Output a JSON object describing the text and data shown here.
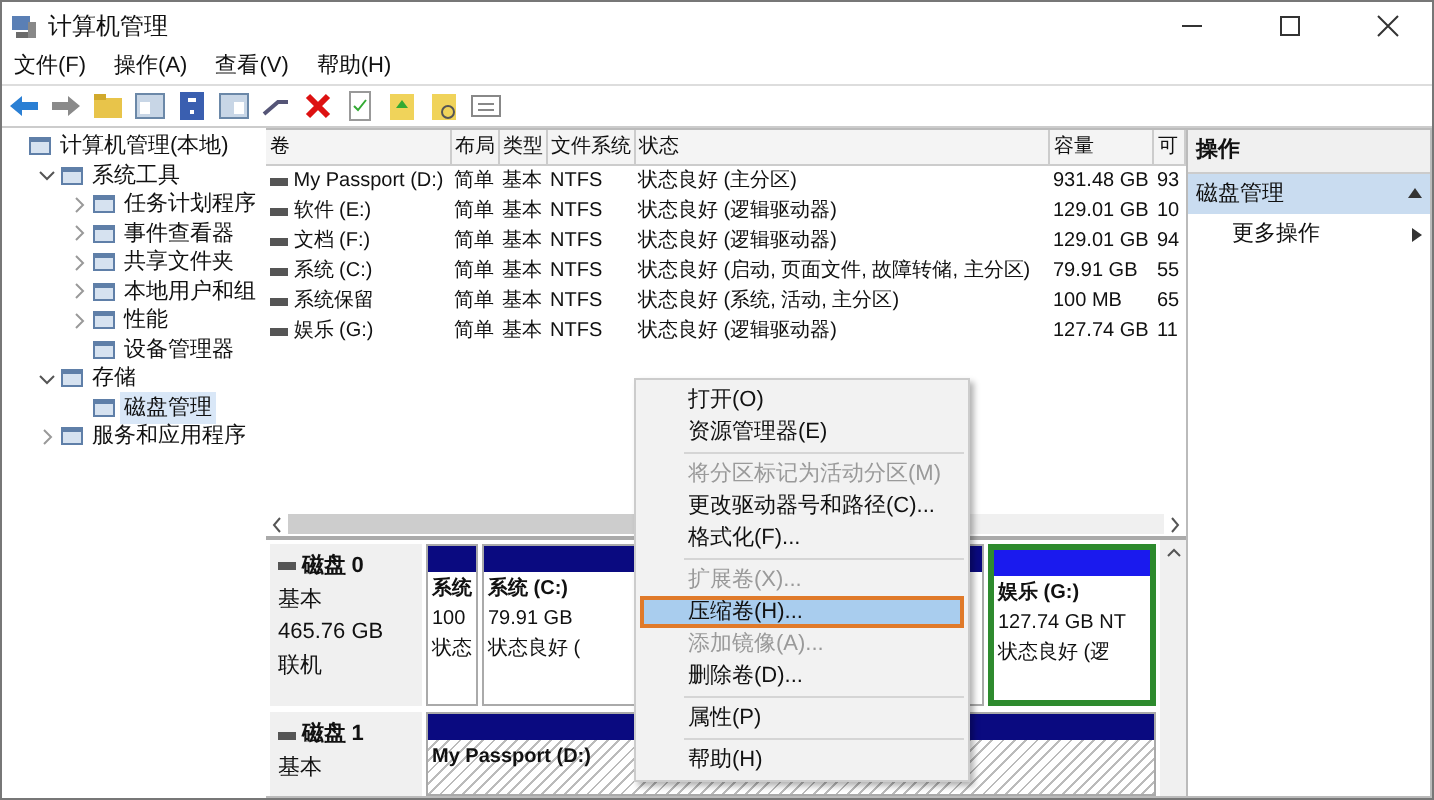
{
  "window": {
    "title": "计算机管理"
  },
  "menu": [
    "文件(F)",
    "操作(A)",
    "查看(V)",
    "帮助(H)"
  ],
  "tree": [
    {
      "label": "计算机管理(本地)",
      "selected": false,
      "children": [
        {
          "label": "系统工具",
          "expanded": true,
          "selected": false,
          "children": [
            {
              "label": "任务计划程序",
              "expanded": false,
              "selected": false
            },
            {
              "label": "事件查看器",
              "expanded": false,
              "selected": false
            },
            {
              "label": "共享文件夹",
              "expanded": false,
              "selected": false
            },
            {
              "label": "本地用户和组",
              "expanded": false,
              "selected": false
            },
            {
              "label": "性能",
              "expanded": false,
              "selected": false
            },
            {
              "label": "设备管理器",
              "selected": false
            }
          ]
        },
        {
          "label": "存储",
          "expanded": true,
          "selected": false,
          "children": [
            {
              "label": "磁盘管理",
              "selected": true
            }
          ]
        },
        {
          "label": "服务和应用程序",
          "expanded": false,
          "selected": false
        }
      ]
    }
  ],
  "table": {
    "columns": [
      "卷",
      "布局",
      "类型",
      "文件系统",
      "状态",
      "容量",
      "可"
    ],
    "rows": [
      [
        "My Passport (D:)",
        "简单",
        "基本",
        "NTFS",
        "状态良好 (主分区)",
        "931.48 GB",
        "93"
      ],
      [
        "软件 (E:)",
        "简单",
        "基本",
        "NTFS",
        "状态良好 (逻辑驱动器)",
        "129.01 GB",
        "10"
      ],
      [
        "文档 (F:)",
        "简单",
        "基本",
        "NTFS",
        "状态良好 (逻辑驱动器)",
        "129.01 GB",
        "94"
      ],
      [
        "系统 (C:)",
        "简单",
        "基本",
        "NTFS",
        "状态良好 (启动, 页面文件, 故障转储, 主分区)",
        "79.91 GB",
        "55"
      ],
      [
        "系统保留",
        "简单",
        "基本",
        "NTFS",
        "状态良好 (系统, 活动, 主分区)",
        "100 MB",
        "65"
      ],
      [
        "娱乐 (G:)",
        "简单",
        "基本",
        "NTFS",
        "状态良好 (逻辑驱动器)",
        "127.74 GB",
        "11"
      ]
    ]
  },
  "disks": [
    {
      "name": "磁盘 0",
      "info": [
        "基本",
        "465.76 GB",
        "联机"
      ],
      "partitions": [
        {
          "kind": "primary",
          "selected": false,
          "lines": [
            "系统",
            "100",
            "状态"
          ]
        },
        {
          "kind": "primary",
          "selected": false,
          "lines": [
            "系统 (C:)",
            "79.91 GB",
            "状态良好 ("
          ]
        },
        {
          "kind": "logical",
          "selected": false,
          "lines": [
            "娱乐 (G:)",
            "127.74 GB NT",
            "状态良好 (逻"
          ]
        }
      ]
    },
    {
      "name": "磁盘 1",
      "info": [
        "基本"
      ],
      "partitions": [
        {
          "kind": "primary",
          "selected": true,
          "lines": [
            "My Passport (D:)"
          ]
        }
      ]
    }
  ],
  "context_menu": [
    {
      "kind": "item",
      "label": "打开(O)",
      "disabled": false,
      "selected": false
    },
    {
      "kind": "item",
      "label": "资源管理器(E)",
      "disabled": false,
      "selected": false
    },
    {
      "kind": "separator"
    },
    {
      "kind": "item",
      "label": "将分区标记为活动分区(M)",
      "disabled": true,
      "selected": false
    },
    {
      "kind": "item",
      "label": "更改驱动器号和路径(C)...",
      "disabled": false,
      "selected": false
    },
    {
      "kind": "item",
      "label": "格式化(F)...",
      "disabled": false,
      "selected": false
    },
    {
      "kind": "separator"
    },
    {
      "kind": "item",
      "label": "扩展卷(X)...",
      "disabled": true,
      "selected": false
    },
    {
      "kind": "item",
      "label": "压缩卷(H)...",
      "disabled": false,
      "selected": true
    },
    {
      "kind": "item",
      "label": "添加镜像(A)...",
      "disabled": true,
      "selected": false
    },
    {
      "kind": "item",
      "label": "删除卷(D)...",
      "disabled": false,
      "selected": false
    },
    {
      "kind": "separator"
    },
    {
      "kind": "item",
      "label": "属性(P)",
      "disabled": false,
      "selected": false
    },
    {
      "kind": "separator"
    },
    {
      "kind": "item",
      "label": "帮助(H)",
      "disabled": false,
      "selected": false
    }
  ],
  "actions": {
    "header": "操作",
    "sections": [
      {
        "title": "磁盘管理",
        "expanded": true,
        "items": [
          "更多操作"
        ]
      }
    ]
  }
}
